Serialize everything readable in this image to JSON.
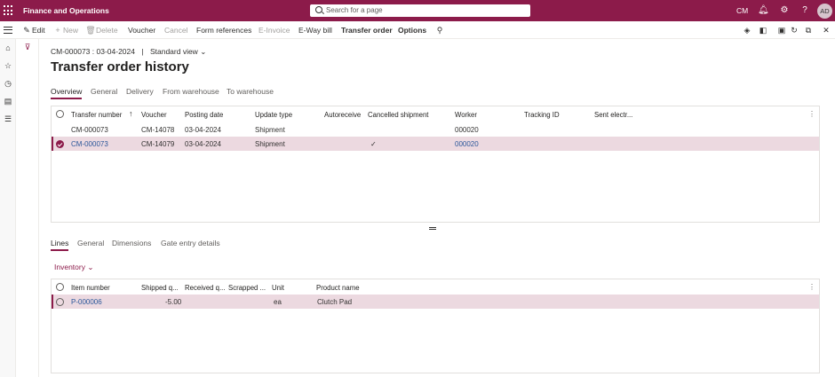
{
  "topbar": {
    "app_title": "Finance and Operations",
    "search_placeholder": "Search for a page",
    "company": "CM",
    "avatar": "AD",
    "icons": [
      "bell-icon",
      "gear-icon",
      "help-icon"
    ]
  },
  "actions": {
    "edit": "Edit",
    "new": "New",
    "delete": "Delete",
    "voucher": "Voucher",
    "cancel": "Cancel",
    "form_references": "Form references",
    "e_invoice": "E-Invoice",
    "eway_bill": "E-Way bill",
    "transfer_order": "Transfer order",
    "options": "Options"
  },
  "page": {
    "crumb_record": "CM-000073 : 03-04-2024",
    "crumb_sep": "|",
    "view": "Standard view",
    "title": "Transfer order history"
  },
  "header_tabs": [
    "Overview",
    "General",
    "Delivery",
    "From warehouse",
    "To warehouse"
  ],
  "history_grid": {
    "columns": [
      "Transfer number",
      "Voucher",
      "Posting date",
      "Update type",
      "Autoreceive",
      "Cancelled shipment",
      "Worker",
      "Tracking ID",
      "Sent electr..."
    ],
    "rows": [
      {
        "transfer_number": "CM-000073",
        "voucher": "CM-14078",
        "posting_date": "03-04-2024",
        "update_type": "Shipment",
        "cancelled": "",
        "worker": "000020",
        "selected": false
      },
      {
        "transfer_number": "CM-000073",
        "voucher": "CM-14079",
        "posting_date": "03-04-2024",
        "update_type": "Shipment",
        "cancelled": "✓",
        "worker": "000020",
        "selected": true
      }
    ]
  },
  "lines_tabs": [
    "Lines",
    "General",
    "Dimensions",
    "Gate entry details"
  ],
  "inventory_button": "Inventory",
  "lines_grid": {
    "columns": [
      "Item number",
      "Shipped q...",
      "Received q...",
      "Scrapped ...",
      "Unit",
      "Product name"
    ],
    "rows": [
      {
        "item_number": "P-000006",
        "shipped": "-5.00",
        "received": "",
        "scrapped": "",
        "unit": "ea",
        "product_name": "Clutch Pad",
        "selected": true
      }
    ]
  },
  "colors": {
    "brand": "#8c1b4a",
    "selected_row": "#ecd9e0",
    "link": "#2b579a"
  }
}
